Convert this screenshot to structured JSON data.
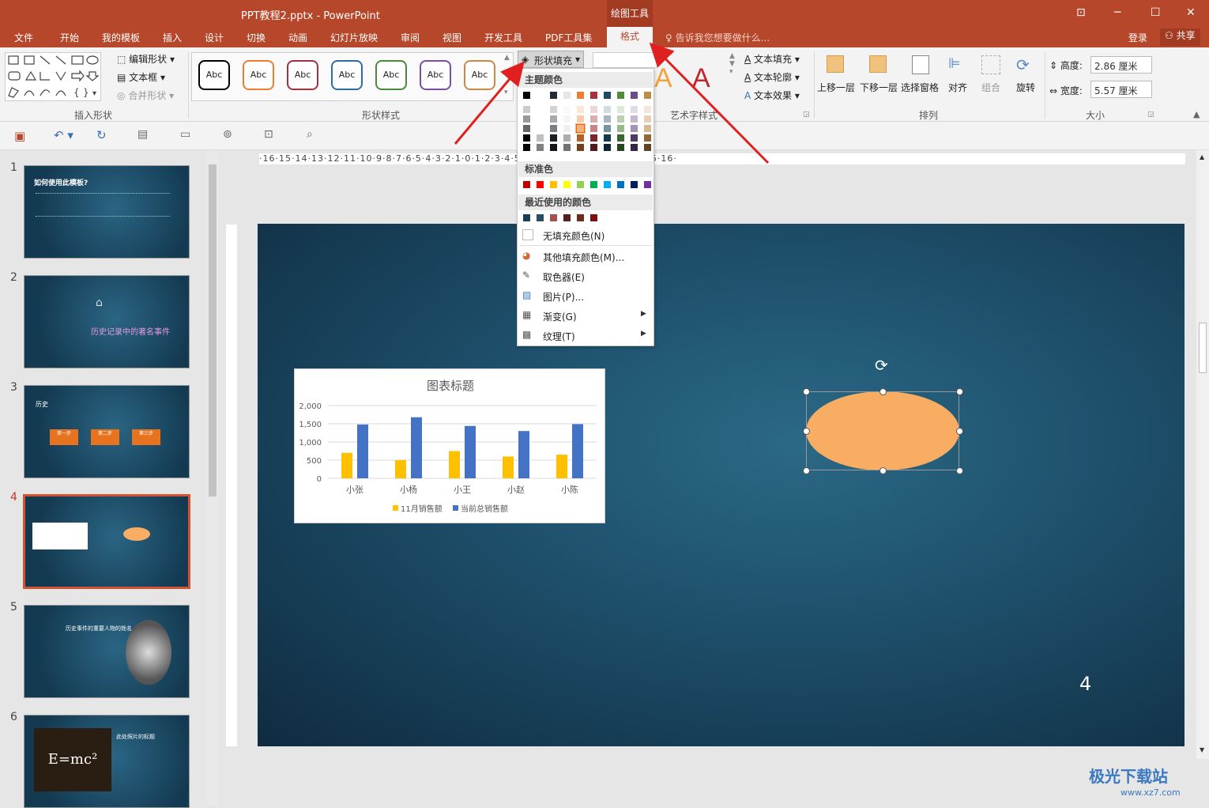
{
  "window": {
    "title": "PPT教程2.pptx - PowerPoint",
    "context_tab": "绘图工具",
    "controls": [
      "⊡",
      "─",
      "☐",
      "✕"
    ]
  },
  "tabs": [
    "文件",
    "开始",
    "我的模板",
    "插入",
    "设计",
    "切换",
    "动画",
    "幻灯片放映",
    "审阅",
    "视图",
    "开发工具",
    "PDF工具集"
  ],
  "active_tab": "格式",
  "tell_me": "告诉我您想要做什么...",
  "login": "登录",
  "share": "共享",
  "ribbon": {
    "insert_shapes": {
      "label": "插入形状",
      "edit_shape": "编辑形状",
      "text_box": "文本框",
      "merge_shapes": "合并形状"
    },
    "shape_styles": {
      "label": "形状样式",
      "swatch_text": "Abc",
      "swatch_colors": [
        "#000000",
        "#ed7d31",
        "#a5313d",
        "#2e6da4",
        "#4b8a3b",
        "#7a4f9e",
        "#c48b47"
      ]
    },
    "shape_fill": "形状填充",
    "wordart": {
      "label": "艺术字样式",
      "text_fill": "文本填充",
      "text_outline": "文本轮廓",
      "text_effects": "文本效果"
    },
    "arrange": {
      "label": "排列",
      "bring_forward": "上移一层",
      "send_backward": "下移一层",
      "selection_pane": "选择窗格",
      "align": "对齐",
      "group": "组合",
      "rotate": "旋转"
    },
    "size": {
      "label": "大小",
      "height_label": "高度:",
      "height": "2.86 厘米",
      "width_label": "宽度:",
      "width": "5.57 厘米"
    }
  },
  "fill_menu": {
    "theme_colors": "主题颜色",
    "standard_colors": "标准色",
    "recent_colors": "最近使用的颜色",
    "no_fill": "无填充颜色(N)",
    "more_colors": "其他填充颜色(M)...",
    "eyedropper": "取色器(E)",
    "picture": "图片(P)...",
    "gradient": "渐变(G)",
    "texture": "纹理(T)",
    "theme_row": [
      "#000000",
      "#ffffff",
      "#222a35",
      "#e7e6e6",
      "#ed7d31",
      "#a5313d",
      "#1d4a66",
      "#4f8b3a",
      "#6b4a8a",
      "#c08a48"
    ],
    "standard_row": [
      "#c00000",
      "#ff0000",
      "#ffc000",
      "#ffff00",
      "#92d050",
      "#00b050",
      "#00b0f0",
      "#0070c0",
      "#002060",
      "#7030a0"
    ],
    "recent_row": [
      "#1b3d55",
      "#2a4d63",
      "#a84f4f",
      "#5a1d1d",
      "#6d2b1b",
      "#7a1010"
    ]
  },
  "slides": [
    {
      "num": "1",
      "title": "如何使用此模板?"
    },
    {
      "num": "2",
      "title": "历史记录中的著名事件"
    },
    {
      "num": "3",
      "title": "历史",
      "steps": [
        "第一步",
        "第二步",
        "第三步"
      ]
    },
    {
      "num": "4"
    },
    {
      "num": "5",
      "title": "历史事件的重要人物的姓名"
    },
    {
      "num": "6",
      "title": "此处照片的标题",
      "formula": "E=mc²"
    }
  ],
  "slide_number": "4",
  "ruler_text": "·16·15·14·13·12·11·10·9·8·7·6·5·4·3·2·1·0·1·2·3·4·5·6·7·8·9·10·11·12·13·14·15·16·",
  "chart_data": {
    "type": "bar",
    "title": "图表标题",
    "categories": [
      "小张",
      "小杨",
      "小王",
      "小赵",
      "小陈"
    ],
    "series": [
      {
        "name": "11月销售额",
        "color": "#ffc000",
        "values": [
          700,
          500,
          750,
          600,
          650
        ]
      },
      {
        "name": "当前总销售额",
        "color": "#4472c4",
        "values": [
          1480,
          1680,
          1440,
          1300,
          1490
        ]
      }
    ],
    "ylim": [
      0,
      2000
    ],
    "yticks": [
      "0",
      "500",
      "1,000",
      "1,500",
      "2,000"
    ],
    "legend": "bottom"
  },
  "watermark": {
    "text": "极光下载站",
    "url": "www.xz7.com"
  }
}
